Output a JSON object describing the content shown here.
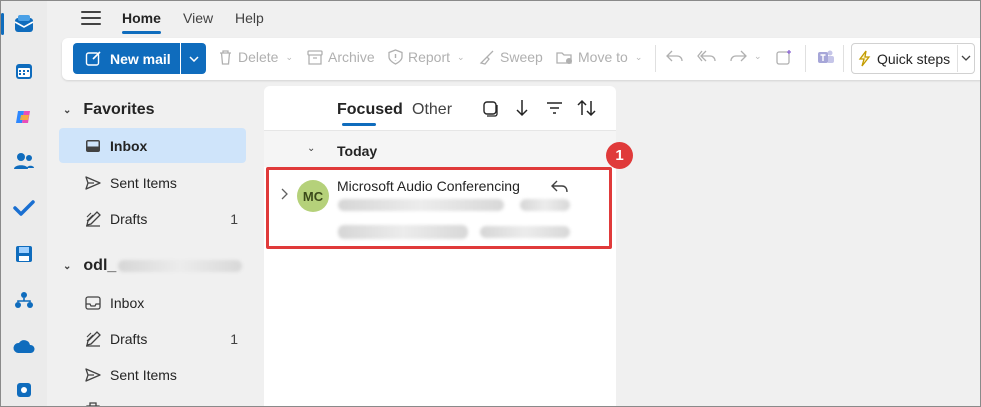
{
  "colors": {
    "accent": "#0f6cbd",
    "selected_folder_bg": "#cfe4fa",
    "highlight_border": "#e03a3a",
    "avatar_bg": "#b5d17a"
  },
  "rail": {
    "items": [
      {
        "icon": "mail-icon"
      },
      {
        "icon": "calendar-icon"
      },
      {
        "icon": "copilot-icon"
      },
      {
        "icon": "people-icon"
      },
      {
        "icon": "todo-check-icon"
      },
      {
        "icon": "save-disk-icon"
      },
      {
        "icon": "org-chart-icon"
      },
      {
        "icon": "onedrive-cloud-icon"
      },
      {
        "icon": "apps-icon"
      }
    ]
  },
  "top_tabs": [
    "Home",
    "View",
    "Help"
  ],
  "ribbon": {
    "new_mail": "New mail",
    "delete": "Delete",
    "archive": "Archive",
    "report": "Report",
    "sweep": "Sweep",
    "move_to": "Move to",
    "quick_steps": "Quick steps"
  },
  "folders": {
    "favorites_title": "Favorites",
    "favorites": [
      {
        "label": "Inbox",
        "icon": "inbox-icon",
        "count": "",
        "selected": true
      },
      {
        "label": "Sent Items",
        "icon": "send-icon",
        "count": ""
      },
      {
        "label": "Drafts",
        "icon": "pencil-icon",
        "count": "1"
      }
    ],
    "account_title": "odl_",
    "account": [
      {
        "label": "Inbox",
        "icon": "inbox-icon",
        "count": ""
      },
      {
        "label": "Drafts",
        "icon": "pencil-icon",
        "count": "1"
      },
      {
        "label": "Sent Items",
        "icon": "send-icon",
        "count": ""
      }
    ]
  },
  "message_list": {
    "tabs": [
      "Focused",
      "Other"
    ],
    "group": "Today",
    "message": {
      "avatar_initials": "MC",
      "sender": "Microsoft Audio Conferencing"
    },
    "callout_number": "1"
  }
}
